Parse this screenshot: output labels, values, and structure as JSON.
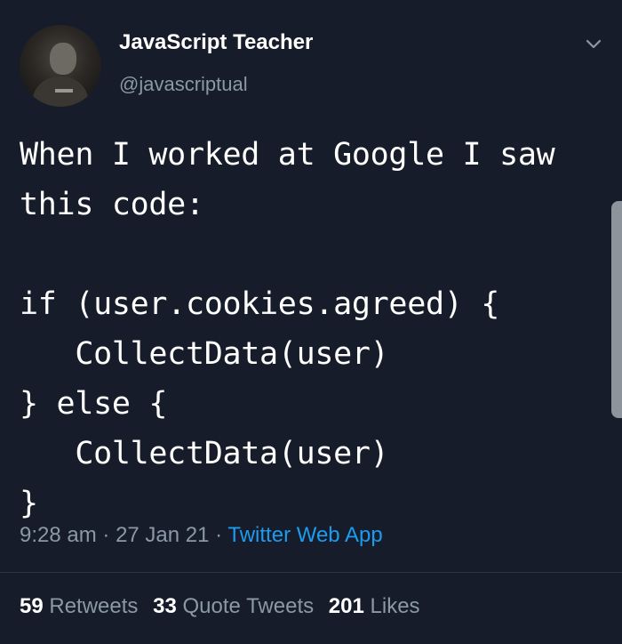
{
  "tweet": {
    "display_name": "JavaScript Teacher",
    "handle": "@javascriptual",
    "text": "When I worked at Google I saw\nthis code:\n\nif (user.cookies.agreed) {\n   CollectData(user)\n} else {\n   CollectData(user)\n}",
    "time": "9:28 am",
    "date": "27 Jan 21",
    "separator": "·",
    "source": "Twitter Web App",
    "stats": {
      "retweets_count": "59",
      "retweets_label": "Retweets",
      "quotes_count": "33",
      "quotes_label": "Quote Tweets",
      "likes_count": "201",
      "likes_label": "Likes"
    }
  },
  "icons": {
    "caret": "chevron-down-icon",
    "avatar": "avatar"
  },
  "colors": {
    "background": "#161c29",
    "text": "#ffffff",
    "secondary_text": "#8b98a5",
    "link": "#1d9bf0"
  }
}
